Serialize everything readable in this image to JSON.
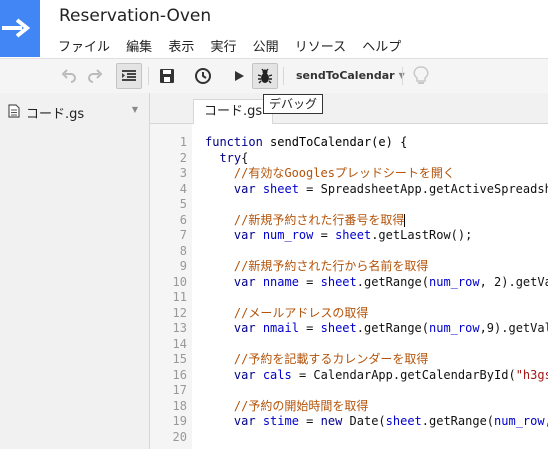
{
  "app": {
    "title": "Reservation-Oven"
  },
  "menu": [
    "ファイル",
    "編集",
    "表示",
    "実行",
    "公開",
    "リソース",
    "ヘルプ"
  ],
  "toolbar": {
    "function_name": "sendToCalendar",
    "tooltip": "デバッグ",
    "icons": [
      "undo-icon",
      "redo-icon",
      "indent-icon",
      "save-icon",
      "clock-icon",
      "run-icon",
      "debug-bug-icon",
      "lightbulb-icon"
    ]
  },
  "sidebar": {
    "file_name": "コード.gs"
  },
  "editor": {
    "tab_label": "コード.gs",
    "line_numbers": [
      "1",
      "2",
      "3",
      "4",
      "5",
      "6",
      "7",
      "8",
      "9",
      "10",
      "11",
      "12",
      "13",
      "14",
      "15",
      "16",
      "17",
      "18",
      "19",
      "20"
    ],
    "lines": [
      [
        {
          "t": "kw",
          "s": "function "
        },
        {
          "t": "fn",
          "s": "sendToCalendar(e) {"
        }
      ],
      [
        {
          "t": "plain",
          "s": "  "
        },
        {
          "t": "kw",
          "s": "try"
        },
        {
          "t": "plain",
          "s": "{"
        }
      ],
      [
        {
          "t": "com",
          "s": "    //有効なGooglesプレッドシートを開く"
        }
      ],
      [
        {
          "t": "plain",
          "s": "    "
        },
        {
          "t": "kw",
          "s": "var "
        },
        {
          "t": "var",
          "s": "sheet"
        },
        {
          "t": "plain",
          "s": " = SpreadsheetApp.getActiveSpreadsheet"
        }
      ],
      [],
      [
        {
          "t": "com",
          "s": "    //新規予約された行番号を取得"
        }
      ],
      [
        {
          "t": "plain",
          "s": "    "
        },
        {
          "t": "kw",
          "s": "var "
        },
        {
          "t": "var",
          "s": "num_row"
        },
        {
          "t": "plain",
          "s": " = "
        },
        {
          "t": "var",
          "s": "sheet"
        },
        {
          "t": "plain",
          "s": ".getLastRow();"
        }
      ],
      [],
      [
        {
          "t": "com",
          "s": "    //新規予約された行から名前を取得"
        }
      ],
      [
        {
          "t": "plain",
          "s": "    "
        },
        {
          "t": "kw",
          "s": "var "
        },
        {
          "t": "var",
          "s": "nname"
        },
        {
          "t": "plain",
          "s": " = "
        },
        {
          "t": "var",
          "s": "sheet"
        },
        {
          "t": "plain",
          "s": ".getRange("
        },
        {
          "t": "var",
          "s": "num_row"
        },
        {
          "t": "plain",
          "s": ", 2).getVa"
        }
      ],
      [],
      [
        {
          "t": "com",
          "s": "    //メールアドレスの取得"
        }
      ],
      [
        {
          "t": "plain",
          "s": "    "
        },
        {
          "t": "kw",
          "s": "var "
        },
        {
          "t": "var",
          "s": "nmail"
        },
        {
          "t": "plain",
          "s": " = "
        },
        {
          "t": "var",
          "s": "sheet"
        },
        {
          "t": "plain",
          "s": ".getRange("
        },
        {
          "t": "var",
          "s": "num_row"
        },
        {
          "t": "plain",
          "s": ",9).getVal"
        }
      ],
      [],
      [
        {
          "t": "com",
          "s": "    //予約を記載するカレンダーを取得"
        }
      ],
      [
        {
          "t": "plain",
          "s": "    "
        },
        {
          "t": "kw",
          "s": "var "
        },
        {
          "t": "var",
          "s": "cals"
        },
        {
          "t": "plain",
          "s": " = CalendarApp.getCalendarById("
        },
        {
          "t": "str",
          "s": "\"h3gs"
        }
      ],
      [],
      [
        {
          "t": "com",
          "s": "    //予約の開始時間を取得"
        }
      ],
      [
        {
          "t": "plain",
          "s": "    "
        },
        {
          "t": "kw",
          "s": "var "
        },
        {
          "t": "var",
          "s": "stime"
        },
        {
          "t": "plain",
          "s": " = "
        },
        {
          "t": "kw",
          "s": "new "
        },
        {
          "t": "plain",
          "s": "Date("
        },
        {
          "t": "var",
          "s": "sheet"
        },
        {
          "t": "plain",
          "s": ".getRange("
        },
        {
          "t": "var",
          "s": "num_row"
        },
        {
          "t": "plain",
          "s": ","
        }
      ],
      []
    ]
  }
}
